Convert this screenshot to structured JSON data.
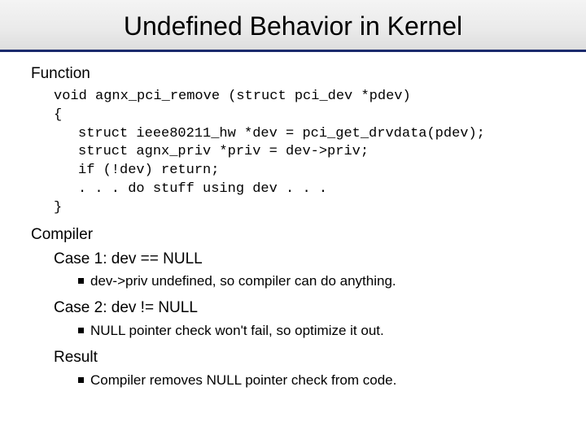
{
  "title": "Undefined Behavior in Kernel",
  "section_function": "Function",
  "code": {
    "l0": "void agnx_pci_remove (struct pci_dev *pdev)",
    "l1": "{",
    "l2": "struct ieee80211_hw *dev = pci_get_drvdata(pdev);",
    "l3": "struct agnx_priv *priv = dev->priv;",
    "l4": "if (!dev) return;",
    "l5": ". . . do stuff using dev . . .",
    "l6": "}"
  },
  "section_compiler": "Compiler",
  "case1_label": "Case 1: dev == NULL",
  "case1_bullet": "dev->priv undefined, so compiler can do anything.",
  "case2_label": "Case 2: dev != NULL",
  "case2_bullet": "NULL pointer check won't fail, so optimize it out.",
  "result_label": "Result",
  "result_bullet": "Compiler removes NULL pointer check from code."
}
